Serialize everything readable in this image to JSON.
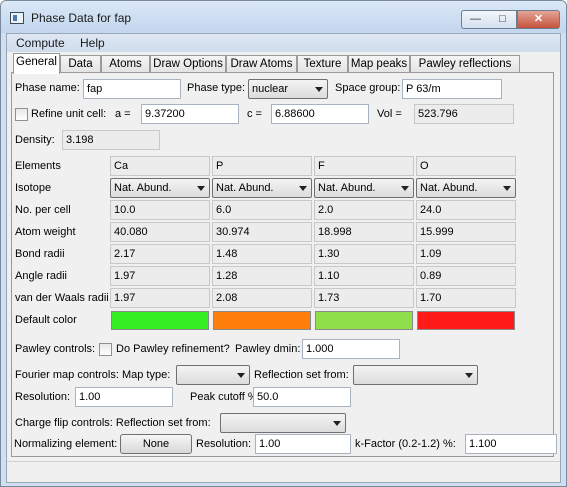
{
  "window": {
    "title": "Phase Data for fap"
  },
  "menu": [
    "Compute",
    "Help"
  ],
  "tabs": [
    "General",
    "Data",
    "Atoms",
    "Draw Options",
    "Draw Atoms",
    "Texture",
    "Map peaks",
    "Pawley reflections"
  ],
  "phase": {
    "name_label": "Phase name:",
    "name": "fap",
    "type_label": "Phase type:",
    "type": "nuclear",
    "space_group_label": "Space group:",
    "space_group": "P 63/m"
  },
  "cell": {
    "refine_label": "Refine unit cell:",
    "a_label": "a =",
    "a": "9.37200",
    "c_label": "c =",
    "c": "6.88600",
    "vol_label": "Vol =",
    "vol": "523.796"
  },
  "density": {
    "label": "Density:",
    "value": "3.198"
  },
  "elements": {
    "row_labels": [
      "Elements",
      "Isotope",
      "No. per cell",
      "Atom weight",
      "Bond radii",
      "Angle radii",
      "van der Waals radii",
      "Default color"
    ],
    "columns": [
      {
        "element": "Ca",
        "isotope": "Nat. Abund.",
        "per_cell": "10.0",
        "weight": "40.080",
        "bond": "2.17",
        "angle": "1.97",
        "vdw": "1.97",
        "color": "#33ee22"
      },
      {
        "element": "P",
        "isotope": "Nat. Abund.",
        "per_cell": "6.0",
        "weight": "30.974",
        "bond": "1.48",
        "angle": "1.28",
        "vdw": "2.08",
        "color": "#ff7f0d"
      },
      {
        "element": "F",
        "isotope": "Nat. Abund.",
        "per_cell": "2.0",
        "weight": "18.998",
        "bond": "1.30",
        "angle": "1.10",
        "vdw": "1.73",
        "color": "#8fdf4a"
      },
      {
        "element": "O",
        "isotope": "Nat. Abund.",
        "per_cell": "24.0",
        "weight": "15.999",
        "bond": "1.09",
        "angle": "0.89",
        "vdw": "1.70",
        "color": "#ff1a1a"
      }
    ]
  },
  "pawley": {
    "label": "Pawley controls:",
    "refine_label": "Do Pawley refinement?",
    "dmin_label": "Pawley dmin:",
    "dmin": "1.000"
  },
  "fourier": {
    "label": "Fourier map controls: Map type:",
    "map_type": "",
    "refl_label": "Reflection set from:",
    "refl_set": "",
    "resolution_label": "Resolution:",
    "resolution": "1.00",
    "cutoff_label": "Peak cutoff %:",
    "cutoff": "50.0"
  },
  "charge_flip": {
    "label": "Charge flip controls: Reflection set from:",
    "refl_set": ""
  },
  "normalizing": {
    "label": "Normalizing element:",
    "button": "None",
    "resolution_label": "Resolution:",
    "resolution": "1.00",
    "kfactor_label": "k-Factor (0.2-1.2) %:",
    "kfactor": "1.100"
  }
}
